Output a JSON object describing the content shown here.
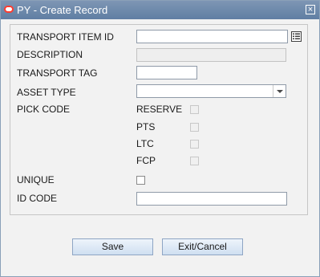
{
  "window": {
    "title": "PY - Create Record",
    "close_symbol": "×"
  },
  "form": {
    "transport_item_id_label": "TRANSPORT ITEM ID",
    "description_label": "DESCRIPTION",
    "transport_tag_label": "TRANSPORT TAG",
    "asset_type_label": "ASSET TYPE",
    "pick_code_label": "PICK CODE",
    "pick_code_options": [
      "RESERVE",
      "PTS",
      "LTC",
      "FCP"
    ],
    "unique_label": "UNIQUE",
    "id_code_label": "ID CODE",
    "transport_item_id_value": "",
    "description_value": "",
    "transport_tag_value": "",
    "asset_type_value": "",
    "id_code_value": "",
    "unique_checked": false
  },
  "buttons": {
    "save_label": "Save",
    "exit_label": "Exit/Cancel"
  },
  "icons": {
    "logo": "oracle-logo-icon",
    "close": "close-icon",
    "lov": "list-of-values-icon",
    "dropdown": "chevron-down-icon"
  },
  "colors": {
    "titlebar": "#6a87ab",
    "logo": "#ff3b2f",
    "button": "#dde8f5"
  }
}
